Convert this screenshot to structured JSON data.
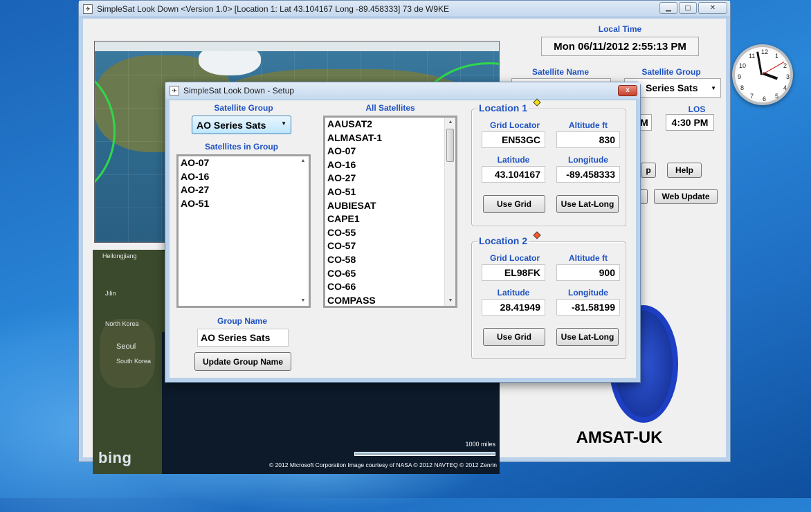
{
  "main_window": {
    "title": "SimpleSat Look Down <Version 1.0>  [Location 1:  Lat 43.104167   Long -89.458333]    73 de W9KE",
    "minimize_icon": "minimize-icon",
    "maximize_icon": "maximize-icon",
    "close_icon": "close-icon"
  },
  "right_panel": {
    "local_time_label": "Local Time",
    "local_time_value": "Mon  06/11/2012  2:55:13 PM",
    "satellite_name_label": "Satellite Name",
    "satellite_group_label": "Satellite Group",
    "satellite_group_value": "Series Sats",
    "los_label": "LOS",
    "los_value": "4:30 PM",
    "aos_value_partial": "M",
    "help_button": "Help",
    "setup_button_partial": "p",
    "web_update_button": "Web Update",
    "logo_text": "AMSAT-UK"
  },
  "bing_map": {
    "labels": [
      "Heilongjiang",
      "Jilin",
      "North Korea",
      "Seoul",
      "South Korea"
    ],
    "logo": "bing",
    "scale_label": "1000 miles",
    "copyright": "© 2012 Microsoft Corporation    Image courtesy of NASA    © 2012 NAVTEQ    © 2012 Zenrin"
  },
  "setup_dialog": {
    "title": "SimpleSat Look Down  - Setup",
    "close_label": "x",
    "satellite_group_label": "Satellite Group",
    "satellite_group_value": "AO Series Sats",
    "satellites_in_group_label": "Satellites in Group",
    "satellites_in_group": [
      "AO-07",
      "AO-16",
      "AO-27",
      "AO-51"
    ],
    "all_satellites_label": "All Satellites",
    "all_satellites": [
      "AAUSAT2",
      "ALMASAT-1",
      "AO-07",
      "AO-16",
      "AO-27",
      "AO-51",
      "AUBIESAT",
      "CAPE1",
      "CO-55",
      "CO-57",
      "CO-58",
      "CO-65",
      "CO-66",
      "COMPASS"
    ],
    "group_name_label": "Group Name",
    "group_name_value": "AO Series Sats",
    "update_group_button": "Update Group Name",
    "location1": {
      "title": "Location 1",
      "marker_color": "#ffe100",
      "grid_locator_label": "Grid Locator",
      "grid_locator": "EN53GC",
      "altitude_label": "Altitude ft",
      "altitude": "830",
      "latitude_label": "Latitude",
      "latitude": "43.104167",
      "longitude_label": "Longitude",
      "longitude": "-89.458333",
      "use_grid_button": "Use Grid",
      "use_latlong_button": "Use Lat-Long"
    },
    "location2": {
      "title": "Location 2",
      "marker_color": "#ff5a1f",
      "grid_locator_label": "Grid Locator",
      "grid_locator": "EL98FK",
      "altitude_label": "Altitude ft",
      "altitude": "900",
      "latitude_label": "Latitude",
      "latitude": "28.41949",
      "longitude_label": "Longitude",
      "longitude": "-81.58199",
      "use_grid_button": "Use Grid",
      "use_latlong_button": "Use Lat-Long"
    }
  },
  "clock": {
    "numbers": [
      "12",
      "1",
      "2",
      "3",
      "4",
      "5",
      "6",
      "7",
      "8",
      "9",
      "10",
      "11"
    ]
  },
  "colors": {
    "label_blue": "#1e52c2",
    "footprint_green": "#2fd84a",
    "logo_blue": "#1d3fc4"
  }
}
